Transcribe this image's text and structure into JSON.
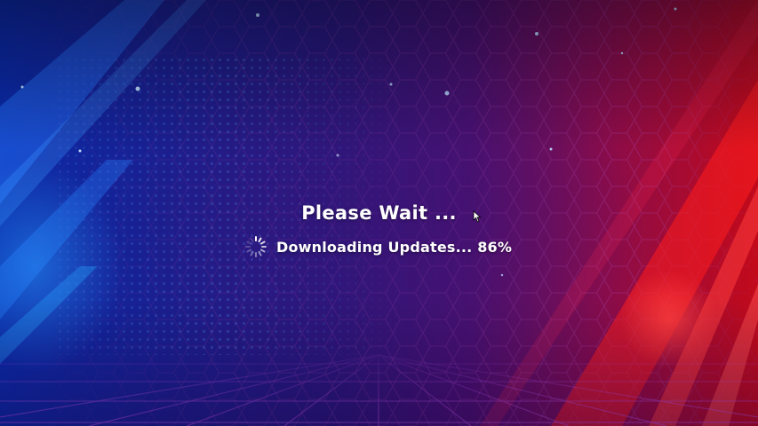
{
  "loading_screen": {
    "title": "Please Wait ...",
    "status_label": "Downloading Updates...",
    "progress_text": "86%",
    "progress": 0.86,
    "spinner_icon": "spinner-icon",
    "cursor_icon": "mouse-cursor-icon"
  },
  "colors": {
    "text": "#ffffff",
    "background_left": "#0a2aa8",
    "background_center": "#2a177a",
    "background_right": "#c30a1a"
  }
}
